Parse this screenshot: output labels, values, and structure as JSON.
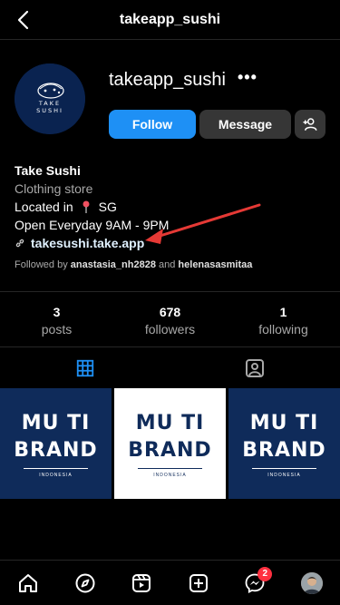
{
  "header": {
    "title": "takeapp_sushi",
    "back_icon": "chevron-left-icon"
  },
  "profile": {
    "username": "takeapp_sushi",
    "more_label": "•••",
    "avatar_text_top": "TAKE",
    "avatar_text_bottom": "SUSHI"
  },
  "actions": {
    "follow_label": "Follow",
    "message_label": "Message",
    "add_user_icon": "add-user-icon"
  },
  "bio": {
    "name": "Take Sushi",
    "category": "Clothing store",
    "location_prefix": "Located in",
    "location_value": "SG",
    "hours": "Open Everyday 9AM - 9PM",
    "link": "takesushi.take.app"
  },
  "followed_by": {
    "prefix": "Followed by",
    "user1": "anastasia_nh2828",
    "conj": "and",
    "user2": "helenasasmitaa"
  },
  "stats": [
    {
      "num": "3",
      "label": "posts"
    },
    {
      "num": "678",
      "label": "followers"
    },
    {
      "num": "1",
      "label": "following"
    }
  ],
  "posts": [
    {
      "line1": "MU TI",
      "line2": "BRAND",
      "sub": "INDONESIA",
      "theme": "dark"
    },
    {
      "line1": "MU TI",
      "line2": "BRAND",
      "sub": "INDONESIA",
      "theme": "light"
    },
    {
      "line1": "MU TI",
      "line2": "BRAND",
      "sub": "INDONESIA",
      "theme": "dark"
    }
  ],
  "nav": {
    "messages_badge": "2"
  },
  "colors": {
    "accent": "#1e90f5",
    "secondary_button": "#363636",
    "badge": "#ff3040",
    "arrow": "#e53935",
    "post_navy": "#0f2b5a"
  }
}
